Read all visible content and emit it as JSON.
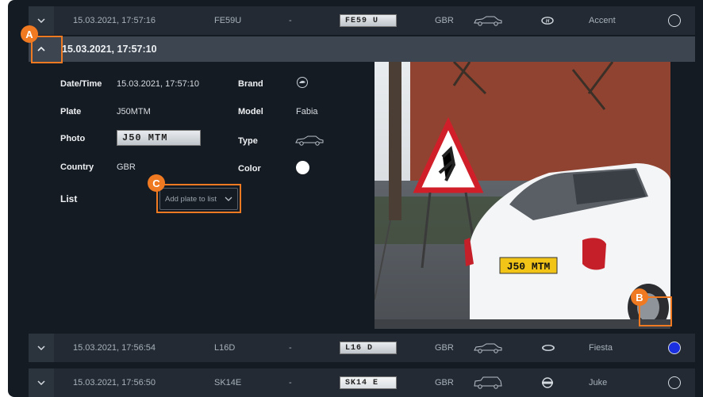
{
  "rows_top": [
    {
      "datetime": "15.03.2021, 17:57:16",
      "plate": "FE59U",
      "list": "-",
      "plate_image_text": "FE59 U",
      "country": "GBR",
      "vehicle_type_icon": "sedan-icon",
      "brand_icon": "hyundai-logo-icon",
      "model": "Accent",
      "color": "none"
    }
  ],
  "expanded": {
    "header_datetime": "15.03.2021, 17:57:10",
    "fields": {
      "datetime_label": "Date/Time",
      "datetime_value": "15.03.2021, 17:57:10",
      "plate_label": "Plate",
      "plate_value": "J50MTM",
      "photo_label": "Photo",
      "photo_plate_text": "J50 MTM",
      "country_label": "Country",
      "country_value": "GBR",
      "list_label": "List",
      "list_dropdown": "Add plate to list",
      "brand_label": "Brand",
      "brand_icon": "skoda-logo-icon",
      "model_label": "Model",
      "model_value": "Fabia",
      "type_label": "Type",
      "type_icon": "sedan-icon",
      "color_label": "Color",
      "color_value": "#ffffff"
    },
    "photo_plate_text": "J50 MTM"
  },
  "rows_bottom": [
    {
      "datetime": "15.03.2021, 17:56:54",
      "plate": "L16D",
      "list": "-",
      "plate_image_text": "L16 D",
      "country": "GBR",
      "vehicle_type_icon": "sedan-icon",
      "brand_icon": "ford-logo-icon",
      "model": "Fiesta",
      "color": "#1a2fe0"
    },
    {
      "datetime": "15.03.2021, 17:56:50",
      "plate": "SK14E",
      "list": "-",
      "plate_image_text": "SK14 E",
      "country": "GBR",
      "vehicle_type_icon": "suv-icon",
      "brand_icon": "nissan-logo-icon",
      "model": "Juke",
      "color": "none"
    }
  ],
  "markers": {
    "a": "A",
    "b": "B",
    "c": "C"
  },
  "colors": {
    "accent": "#f07a22",
    "panel": "#151b22",
    "row": "#232a33",
    "header": "#3d4550"
  }
}
